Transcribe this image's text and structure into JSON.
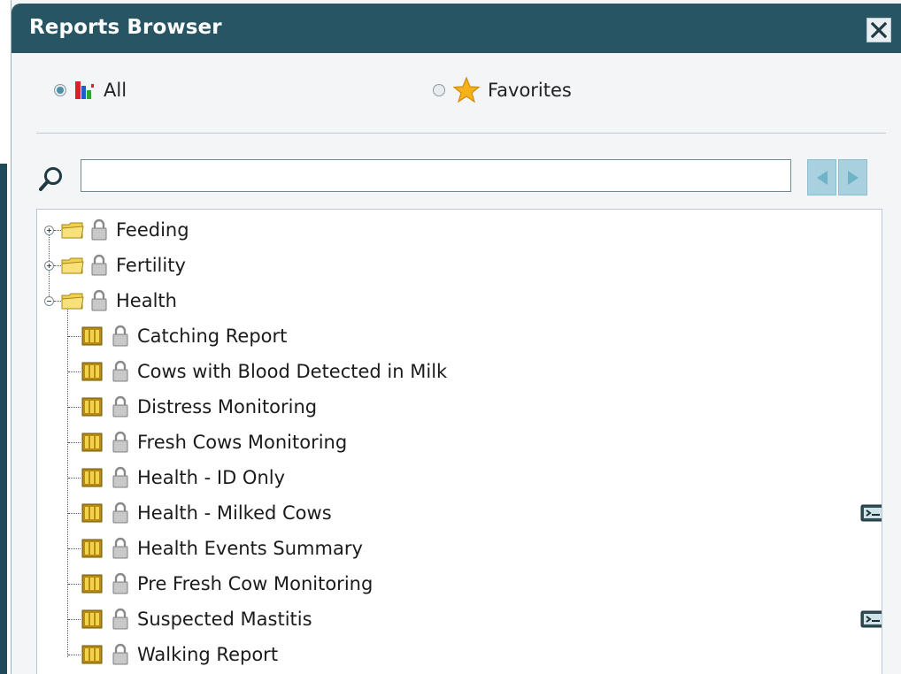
{
  "window": {
    "title": "Reports Browser"
  },
  "filters": {
    "all_label": "All",
    "favorites_label": "Favorites",
    "selected": "All"
  },
  "search": {
    "value": "",
    "placeholder": ""
  },
  "tree": {
    "folders": [
      {
        "label": "Feeding",
        "expanded": false
      },
      {
        "label": "Fertility",
        "expanded": false
      },
      {
        "label": "Health",
        "expanded": true
      }
    ],
    "health_reports": [
      {
        "label": "Catching Report",
        "badge": false
      },
      {
        "label": "Cows with Blood Detected in Milk",
        "badge": false
      },
      {
        "label": "Distress Monitoring",
        "badge": false
      },
      {
        "label": "Fresh Cows Monitoring",
        "badge": false
      },
      {
        "label": "Health - ID Only",
        "badge": false
      },
      {
        "label": "Health - Milked Cows",
        "badge": true
      },
      {
        "label": "Health Events Summary",
        "badge": false
      },
      {
        "label": "Pre Fresh Cow Monitoring",
        "badge": false
      },
      {
        "label": "Suspected Mastitis",
        "badge": true
      },
      {
        "label": "Walking Report",
        "badge": false
      }
    ]
  },
  "colors": {
    "titlebar": "#275563",
    "nav_button": "#a8d0de",
    "folder": "#f2d04a",
    "report_icon": "#b58a17"
  }
}
